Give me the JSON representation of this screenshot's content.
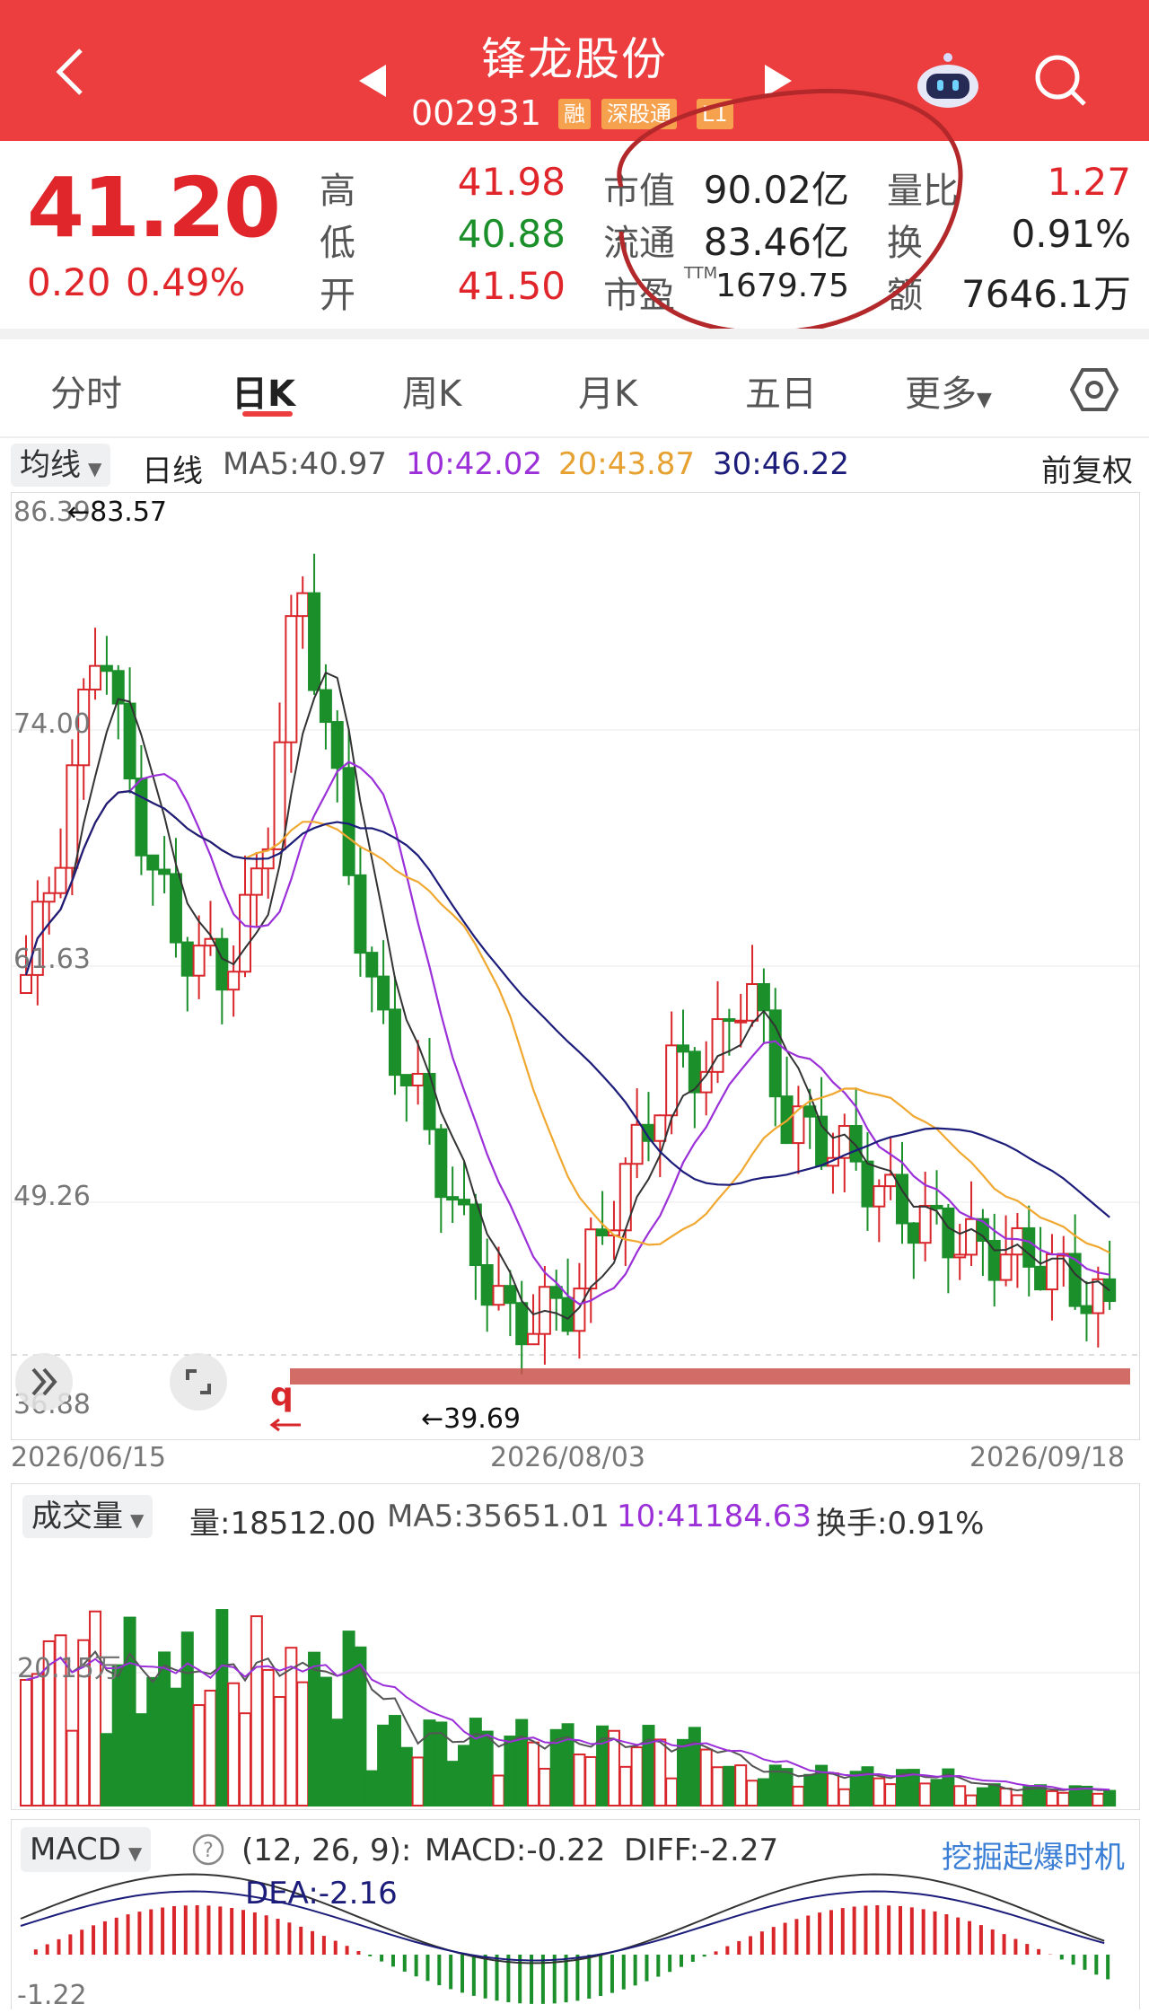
{
  "header": {
    "title": "锋龙股份",
    "code": "002931",
    "tags": [
      "融",
      "深股通",
      "L1"
    ],
    "back_icon": "chevron-left-icon",
    "prev_icon": "triangle-left-icon",
    "next_icon": "triangle-right-icon",
    "robot_icon": "robot-icon",
    "search_icon": "search-icon",
    "bg_color": "#ec3d3f"
  },
  "quote": {
    "price": "41.20",
    "change": "0.20",
    "change_pct": "0.49%",
    "high_label": "高",
    "high": "41.98",
    "low_label": "低",
    "low": "40.88",
    "open_label": "开",
    "open": "41.50",
    "mkt_cap_label": "市值",
    "mkt_cap": "90.02亿",
    "float_label": "流通",
    "float_cap": "83.46亿",
    "pe_label": "市盈",
    "pe_sup": "TTM",
    "pe": "1679.75",
    "vol_ratio_label": "量比",
    "vol_ratio": "1.27",
    "turnover_label": "换",
    "turnover": "0.91%",
    "amount_label": "额",
    "amount": "7646.1万"
  },
  "tabs": [
    "分时",
    "日K",
    "周K",
    "月K",
    "五日",
    "更多"
  ],
  "tabs_active": "日K",
  "settings_icon": "hexagon-gear-icon",
  "kline": {
    "indicator": "均线",
    "period": "日线",
    "ma5": "MA5:40.97",
    "ma10": "10:42.02",
    "ma20": "20:43.87",
    "ma30": "30:46.22",
    "adjust": "前复权",
    "y_labels": [
      "86.39",
      "74.00",
      "61.63",
      "49.26",
      "36.88"
    ],
    "high_mark": "←83.57",
    "low_mark": "←39.69",
    "dates": [
      "2026/06/15",
      "2026/08/03",
      "2026/09/18"
    ],
    "colors": {
      "ma5": "#333333",
      "ma10": "#9b30d9",
      "ma20": "#f0a830",
      "ma30": "#1c1c7a",
      "up": "#d9262b",
      "down": "#1a8f2a"
    }
  },
  "volume": {
    "indicator": "成交量",
    "vol": "量:18512.00",
    "ma5": "MA5:35651.01",
    "ma10": "10:41184.63",
    "turnover": "换手:0.91%",
    "y_label": "20.15万"
  },
  "macd": {
    "indicator": "MACD",
    "params": "(12, 26, 9):",
    "macd": "MACD:-0.22",
    "diff": "DIFF:-2.27",
    "dea": "DEA:-2.16",
    "y_label": "-1.22",
    "link": "挖掘起爆时机",
    "help_icon": "question-circle-icon"
  },
  "float_buttons": {
    "expand_icon": "double-chevron-right-icon",
    "fullscreen_icon": "fullscreen-icon"
  },
  "annot_q": "q"
}
